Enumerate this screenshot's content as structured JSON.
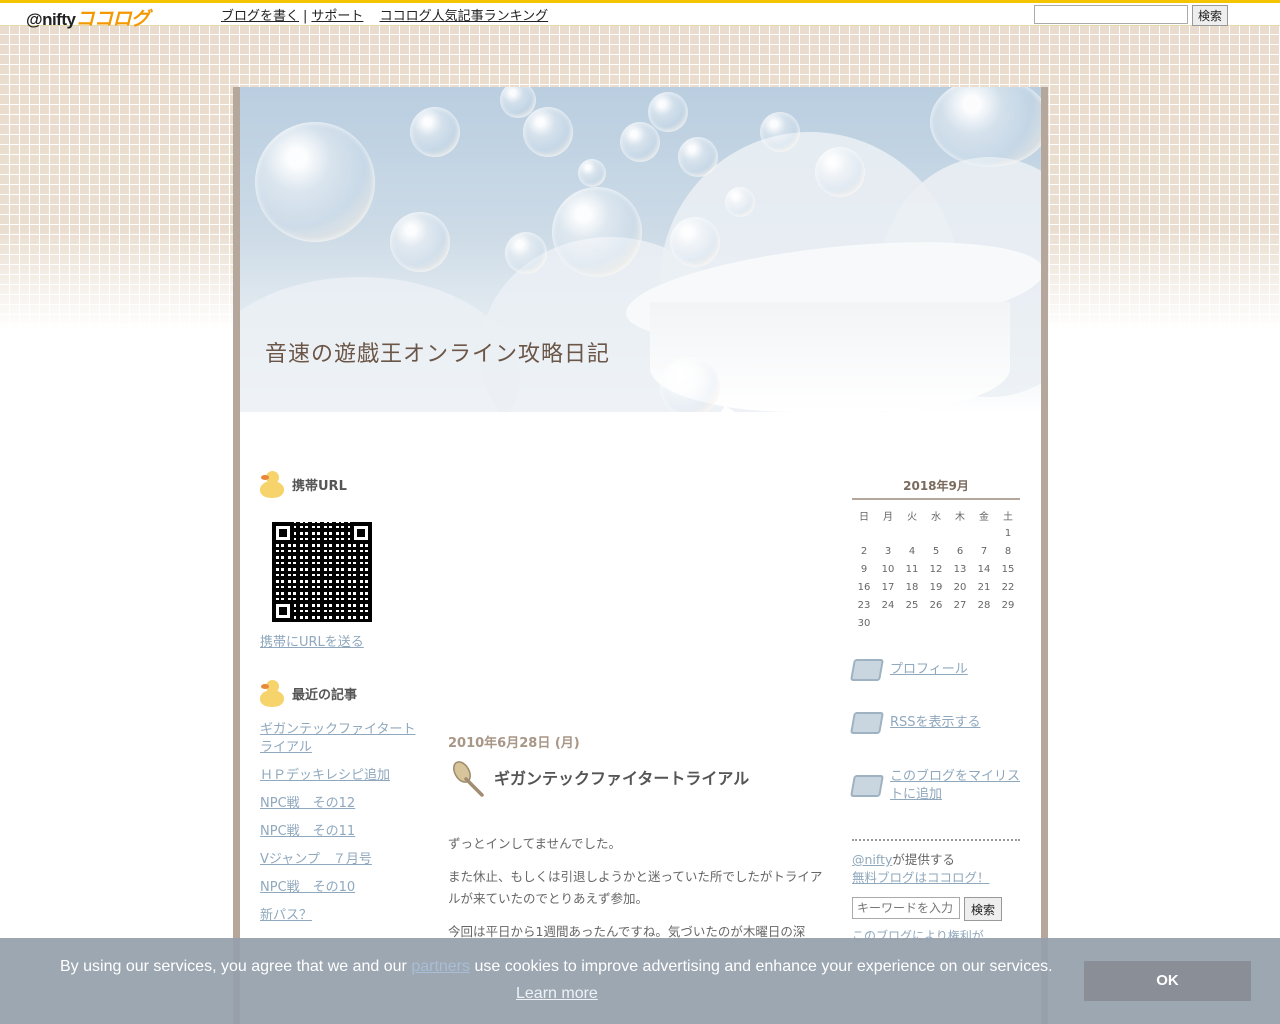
{
  "topbar": {
    "logo_prefix": "@nifty",
    "logo_brand": "ココログ",
    "links": [
      "ブログを書く",
      "サポート",
      "ココログ人気記事ランキング"
    ],
    "separator": "|",
    "search_button": "検索"
  },
  "blog": {
    "title": "音速の遊戯王オンライン攻略日記"
  },
  "left": {
    "mobile_heading": "携帯URL",
    "mobile_link": "携帯にURLを送る",
    "recent_heading": "最近の記事",
    "recent_items": [
      "ギガンテックファイタートライアル",
      "ＨＰデッキレシピ追加",
      "NPC戦　その12",
      "NPC戦　その11",
      "Vジャンプ　７月号",
      "NPC戦　その10",
      "新パス？"
    ]
  },
  "post": {
    "date": "2010年6月28日 (月)",
    "title": "ギガンテックファイタートライアル",
    "paragraphs": [
      "ずっとインしてませんでした。",
      "また休止、もしくは引退しようかと迷っていた所でしたがトライアルが来ていたのでとりあえず参加。",
      "今回は平日から1週間あったんですね。気づいたのが木曜日の深"
    ]
  },
  "calendar": {
    "title": "2018年9月",
    "weekdays": [
      "日",
      "月",
      "火",
      "水",
      "木",
      "金",
      "土"
    ],
    "weeks": [
      [
        "",
        "",
        "",
        "",
        "",
        "",
        "1"
      ],
      [
        "2",
        "3",
        "4",
        "5",
        "6",
        "7",
        "8"
      ],
      [
        "9",
        "10",
        "11",
        "12",
        "13",
        "14",
        "15"
      ],
      [
        "16",
        "17",
        "18",
        "19",
        "20",
        "21",
        "22"
      ],
      [
        "23",
        "24",
        "25",
        "26",
        "27",
        "28",
        "29"
      ],
      [
        "30",
        "",
        "",
        "",
        "",
        "",
        ""
      ]
    ]
  },
  "right": {
    "links": [
      "プロフィール",
      "RSSを表示する",
      "このブログをマイリストに追加"
    ],
    "nifty_link": "@nifty",
    "nifty_text1": "が提供する",
    "nifty_text2": "無料ブログはココログ！",
    "search_placeholder": "キーワードを入力",
    "search_button": "検索",
    "partial_line": "このブログにより権利が"
  },
  "cookie": {
    "text_before": "By using our services, you agree that we and our ",
    "partners": "partners",
    "text_after": " use cookies to improve advertising and enhance your experience on our services.",
    "learn_more": "Learn more",
    "ok": "OK"
  }
}
